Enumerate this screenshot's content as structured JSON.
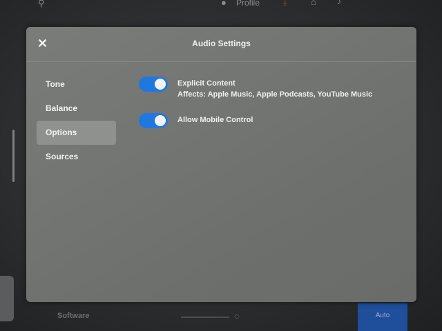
{
  "topbar": {
    "profile_label": "Profile"
  },
  "dialog": {
    "title": "Audio Settings",
    "close_icon": "close-icon"
  },
  "nav": {
    "items": [
      {
        "label": "Tone"
      },
      {
        "label": "Balance"
      },
      {
        "label": "Options",
        "active": true
      },
      {
        "label": "Sources"
      }
    ]
  },
  "options": {
    "explicit_content": {
      "label": "Explicit Content",
      "sublabel": "Affects: Apple Music, Apple Podcasts, YouTube Music",
      "enabled": true
    },
    "mobile_control": {
      "label": "Allow Mobile Control",
      "enabled": true
    }
  },
  "bottombar": {
    "software_label": "Software",
    "auto_label": "Auto"
  },
  "colors": {
    "accent": "#1f78e0",
    "panel": "#757775",
    "text": "#f0f0f0"
  }
}
